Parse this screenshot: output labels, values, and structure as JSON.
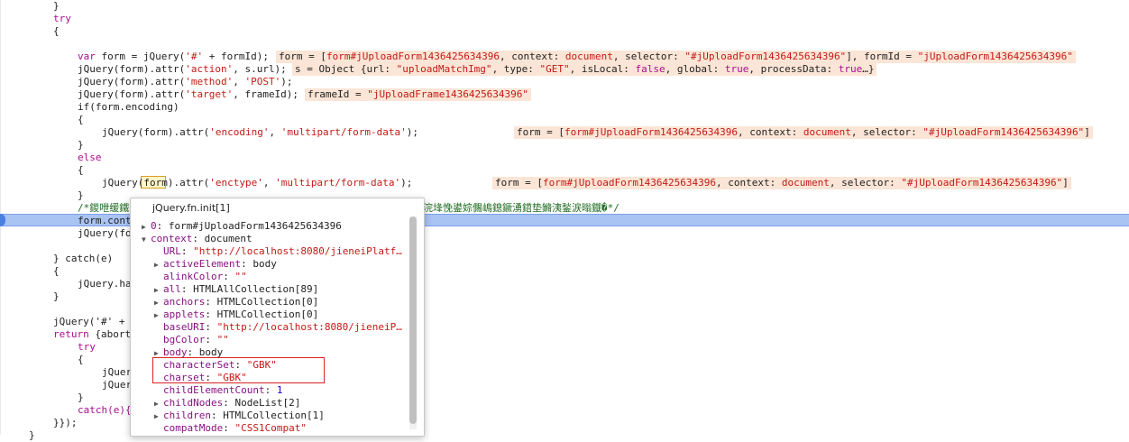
{
  "code": {
    "l_close1": "}",
    "try_kw": "try",
    "open1": "{",
    "var_kw": "var",
    "l_form1": " form = jQuery(",
    "l_form1_s": "'#'",
    "l_form1_b": " + formId);",
    "l_action_a": "jQuery(form).attr(",
    "l_action_s": "'action'",
    "l_action_b": ", s.url);",
    "l_method_a": "jQuery(form).attr(",
    "l_method_s1": "'method'",
    "l_method_c": ", ",
    "l_method_s2": "'POST'",
    "l_method_d": ");",
    "l_target_a": "jQuery(form).attr(",
    "l_target_s": "'target'",
    "l_target_b": ", frameId);",
    "l_if": "if(form.encoding)",
    "open2": "{",
    "l_enc_a": "jQuery(form).attr(",
    "l_enc_s1": "'encoding'",
    "l_enc_c": ", ",
    "l_enc_s2": "'multipart/form-data'",
    "l_enc_d": ");",
    "close2": "}",
    "else_kw": "else",
    "open3": "{",
    "l_enct_a": "jQuery(",
    "l_enct_form": "form",
    "l_enct_b": ").attr(",
    "l_enct_s1": "'enctype'",
    "l_enct_c": ", ",
    "l_enct_s2": "'multipart/form-data'",
    "l_enct_d": ");",
    "close3": "}",
    "l_comment_a": "/*鍐呭缓鐵",
    "l_comment_b": "浣埄悗鍙婃儩嶋鎴鐝湧鍣垫鏅洟鍫涙暡鐡�*/",
    "l_submit": "form.cont",
    "l_jq": "jQuery(fo",
    "l_catch": "} catch(e)",
    "open4": "{",
    "l_handle": "jQuery.ha",
    "close4": "}",
    "l_jq2": "jQuery('#' +",
    "l_return_kw": "return",
    "l_return_b": " {abort",
    "try2": "try",
    "open5": "{",
    "l_jq3": "jQuer",
    "l_jq4": "jQuer",
    "close5": "}",
    "l_catch2": "catch(e){",
    "l_end": "}});",
    "l_last": "}"
  },
  "inline_values": {
    "v1_a": "form = [",
    "v1_b": "form#jUploadForm1436425634396",
    "v1_c": ", context: ",
    "v1_d": "document",
    "v1_e": ", selector: ",
    "v1_f": "\"#jUploadForm1436425634396\"",
    "v1_g": "], formId = ",
    "v1_h": "\"jUploadForm1436425634396\"",
    "v2_a": "s = Object {url: ",
    "v2_b": "\"uploadMatchImg\"",
    "v2_c": ", type: ",
    "v2_d": "\"GET\"",
    "v2_e": ", isLocal: ",
    "v2_f": "false",
    "v2_g": ", global: ",
    "v2_h": "true",
    "v2_i": ", processData: ",
    "v2_j": "true",
    "v2_k": "…}",
    "v3_a": "frameId = ",
    "v3_b": "\"jUploadFrame1436425634396\"",
    "v4_a": "form = [",
    "v4_b": "form#jUploadForm1436425634396",
    "v4_c": ", context: ",
    "v4_d": "document",
    "v4_e": ", selector: ",
    "v4_f": "\"#jUploadForm1436425634396\"",
    "v4_g": "]",
    "v5_a": "form = [",
    "v5_b": "form#jUploadForm1436425634396",
    "v5_c": ", context: ",
    "v5_d": "document",
    "v5_e": ", selector: ",
    "v5_f": "\"#jUploadForm1436425634396\"",
    "v5_g": "]"
  },
  "popover": {
    "title": "jQuery.fn.init[1]",
    "rows": [
      {
        "tri": "▶",
        "key": "0",
        "val": "form#jUploadForm1436425634396",
        "vt": "o"
      },
      {
        "tri": "▼",
        "key": "context",
        "val": "document",
        "vt": "o"
      },
      {
        "tri": "",
        "key": "URL",
        "val": "\"http://localhost:8080/jieneiPlatf…",
        "vt": "s"
      },
      {
        "tri": "▶",
        "key": "activeElement",
        "val": "body",
        "vt": "o"
      },
      {
        "tri": "",
        "key": "alinkColor",
        "val": "\"\"",
        "vt": "s"
      },
      {
        "tri": "▶",
        "key": "all",
        "val": "HTMLAllCollection[89]",
        "vt": "o"
      },
      {
        "tri": "▶",
        "key": "anchors",
        "val": "HTMLCollection[0]",
        "vt": "o"
      },
      {
        "tri": "▶",
        "key": "applets",
        "val": "HTMLCollection[0]",
        "vt": "o"
      },
      {
        "tri": "",
        "key": "baseURI",
        "val": "\"http://localhost:8080/jieneiP…",
        "vt": "s"
      },
      {
        "tri": "",
        "key": "bgColor",
        "val": "\"\"",
        "vt": "s"
      },
      {
        "tri": "▶",
        "key": "body",
        "val": "body",
        "vt": "o"
      },
      {
        "tri": "",
        "key": "characterSet",
        "val": "\"GBK\"",
        "vt": "s"
      },
      {
        "tri": "",
        "key": "charset",
        "val": "\"GBK\"",
        "vt": "s"
      },
      {
        "tri": "",
        "key": "childElementCount",
        "val": "1",
        "vt": "n"
      },
      {
        "tri": "▶",
        "key": "childNodes",
        "val": "NodeList[2]",
        "vt": "o"
      },
      {
        "tri": "▶",
        "key": "children",
        "val": "HTMLCollection[1]",
        "vt": "o"
      },
      {
        "tri": "",
        "key": "compatMode",
        "val": "\"CSS1Compat\"",
        "vt": "s"
      }
    ]
  }
}
